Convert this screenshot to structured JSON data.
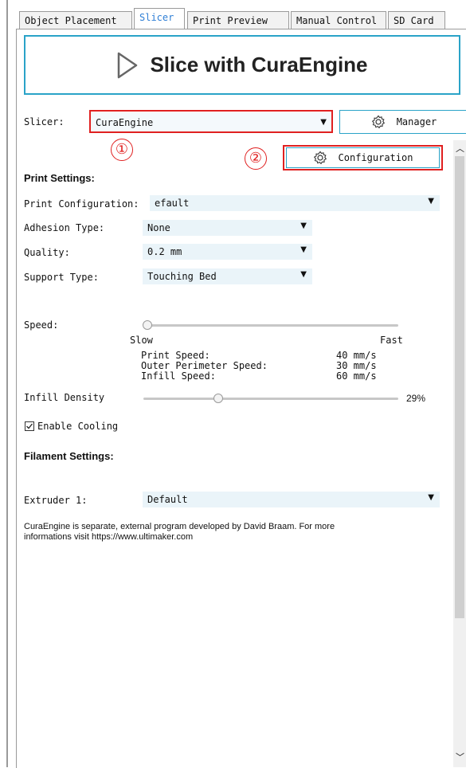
{
  "tabs": [
    {
      "label": "Object Placement",
      "active": false
    },
    {
      "label": "Slicer",
      "active": true
    },
    {
      "label": "Print Preview",
      "active": false
    },
    {
      "label": "Manual Control",
      "active": false
    },
    {
      "label": "SD Card",
      "active": false
    }
  ],
  "slice_button": {
    "label": "Slice with CuraEngine",
    "icon": "play-icon"
  },
  "slicer": {
    "label": "Slicer:",
    "value": "CuraEngine",
    "manager_label": "Manager",
    "configuration_label": "Configuration"
  },
  "annotations": {
    "one": "①",
    "two": "②",
    "color": "#e02020"
  },
  "print_settings": {
    "heading": "Print Settings:",
    "print_configuration": {
      "label": "Print Configuration:",
      "value": "efault"
    },
    "adhesion": {
      "label": "Adhesion Type:",
      "value": "None"
    },
    "quality": {
      "label": "Quality:",
      "value": "0.2 mm"
    },
    "support": {
      "label": "Support Type:",
      "value": "Touching Bed"
    }
  },
  "speed": {
    "label": "Speed:",
    "slow": "Slow",
    "fast": "Fast",
    "level": 0,
    "rows": [
      {
        "label": "Print Speed:",
        "value": "40 mm/s"
      },
      {
        "label": "Outer Perimeter Speed:",
        "value": "30 mm/s"
      },
      {
        "label": "Infill Speed:",
        "value": "60 mm/s"
      }
    ]
  },
  "infill": {
    "label": "Infill Density",
    "value": "29%",
    "level": 0.29
  },
  "cooling": {
    "label": "Enable Cooling",
    "checked": true
  },
  "filament": {
    "heading": "Filament Settings:",
    "extruder": {
      "label": "Extruder 1:",
      "value": "Default"
    }
  },
  "info": {
    "line1": "CuraEngine is separate, external program developed by David Braam. For more",
    "line2": "informations visit https://www.ultimaker.com"
  },
  "colors": {
    "accent": "#2aa3c8",
    "active_tab": "#2f7fd6",
    "annotation": "#e02020"
  }
}
